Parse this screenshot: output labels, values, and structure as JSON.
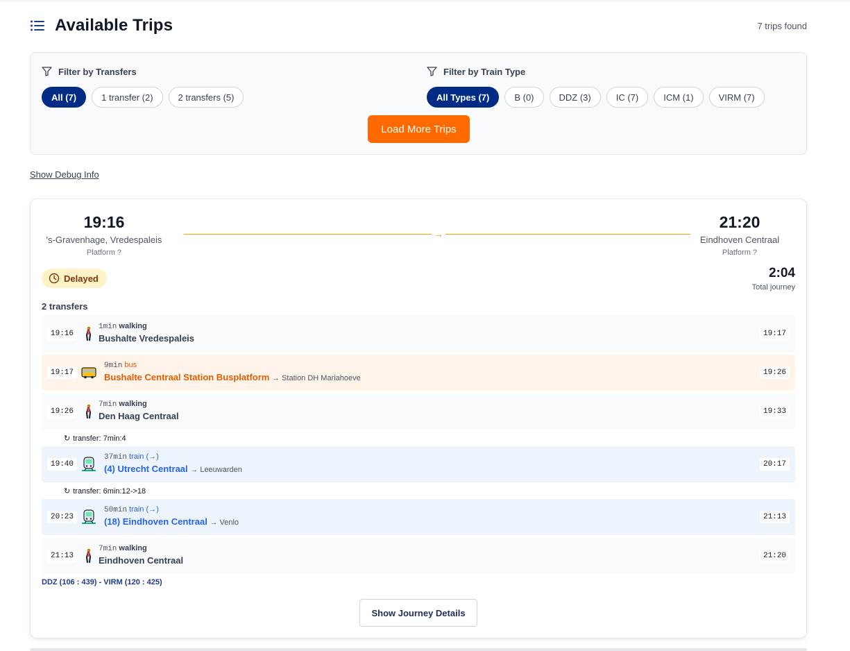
{
  "header": {
    "title": "Available Trips",
    "count": "7 trips found"
  },
  "filters": {
    "transfers": {
      "label": "Filter by Transfers",
      "options": [
        "All (7)",
        "1 transfer (2)",
        "2 transfers (5)"
      ],
      "selected": "All (7)"
    },
    "types": {
      "label": "Filter by Train Type",
      "options": [
        "All Types (7)",
        "B (0)",
        "DDZ (3)",
        "IC (7)",
        "ICM (1)",
        "VIRM (7)"
      ],
      "selected": "All Types (7)"
    },
    "load_more": "Load More Trips"
  },
  "debug_link": "Show Debug Info",
  "trip": {
    "departure": {
      "time": "19:16",
      "station": "'s-Gravenhage, Vredespaleis",
      "platform": "Platform ?"
    },
    "arrival": {
      "time": "21:20",
      "station": "Eindhoven Centraal",
      "platform": "Platform ?"
    },
    "status": "Delayed",
    "duration": "2:04",
    "duration_label": "Total journey",
    "transfers": "2 transfers",
    "legs": [
      {
        "start": "19:16",
        "end": "19:17",
        "mins": "1min",
        "mode": "walking",
        "stop": "Bushalte Vredespaleis",
        "direction": "",
        "kind": "walk"
      },
      {
        "start": "19:17",
        "end": "19:26",
        "mins": "9min",
        "mode": "bus",
        "stop": "Bushalte Centraal Station Busplatform",
        "direction": "→ Station DH Mariahoeve",
        "kind": "bus"
      },
      {
        "start": "19:26",
        "end": "19:33",
        "mins": "7min",
        "mode": "walking",
        "stop": "Den Haag Centraal",
        "direction": "",
        "kind": "walk"
      },
      {
        "start": "19:40",
        "end": "20:17",
        "mins": "37min",
        "mode": "train (→)",
        "stop": "(4) Utrecht Centraal",
        "direction": "→ Leeuwarden",
        "kind": "train"
      },
      {
        "start": "20:23",
        "end": "21:13",
        "mins": "50min",
        "mode": "train (→)",
        "stop": "(18) Eindhoven Centraal",
        "direction": "→ Venlo",
        "kind": "train"
      },
      {
        "start": "21:13",
        "end": "21:20",
        "mins": "7min",
        "mode": "walking",
        "stop": "Eindhoven Centraal",
        "direction": "",
        "kind": "walk"
      }
    ],
    "transfer_notes": [
      "transfer: 7min:4",
      "transfer: 6min:12->18"
    ],
    "composition": "DDZ (106 : 439) - VIRM (120 : 425)",
    "details_button": "Show Journey Details"
  },
  "icons": {
    "list": "list-icon",
    "filter": "filter-icon",
    "clock": "clock-icon",
    "walk": "walking-person-icon",
    "bus": "bus-icon",
    "train": "train-icon",
    "transfer": "transfer-cycle-icon"
  },
  "colors": {
    "primary": "#002c86",
    "accent": "#ff6a00",
    "route": "#e5a700",
    "train": "#2563eb",
    "bus": "#e25c00",
    "delayed_bg": "#fef3c7"
  }
}
